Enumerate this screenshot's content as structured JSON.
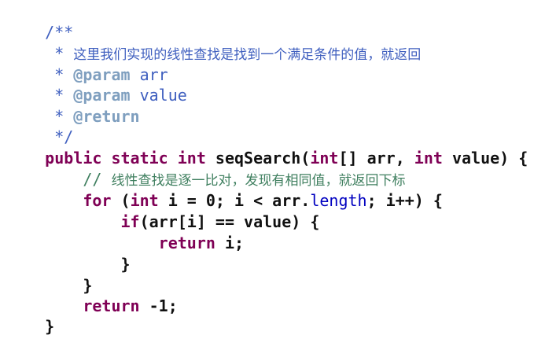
{
  "code": {
    "l1": "/**",
    "l2_star": " * ",
    "l2_text": "这里我们实现的线性查找是找到一个满足条件的值，就返回",
    "l3_star": " * ",
    "l3_tag": "@param",
    "l3_name": " arr",
    "l4_star": " * ",
    "l4_tag": "@param",
    "l4_name": " value",
    "l5_star": " * ",
    "l5_tag": "@return",
    "l6": " */",
    "l7_public": "public",
    "l7_static": " static",
    "l7_int": " int",
    "l7_name": " seqSearch(",
    "l7_int2": "int",
    "l7_arr": "[] arr, ",
    "l7_int3": "int",
    "l7_rest": " value) {",
    "l8_slashes": "    // ",
    "l8_text": "线性查找是逐一比对，发现有相同值，就返回下标",
    "l9_for": "    for",
    "l9_a": " (",
    "l9_int": "int",
    "l9_b": " i = 0; i < arr.",
    "l9_length": "length",
    "l9_c": "; i++) {",
    "l10_indent": "        ",
    "l10_if": "if",
    "l10_rest": "(arr[i] == value) {",
    "l11_indent": "            ",
    "l11_return": "return",
    "l11_rest": " i;",
    "l12": "        }",
    "l13": "    }",
    "l14_indent": "    ",
    "l14_return": "return",
    "l14_rest": " -1;",
    "l15": "}"
  }
}
